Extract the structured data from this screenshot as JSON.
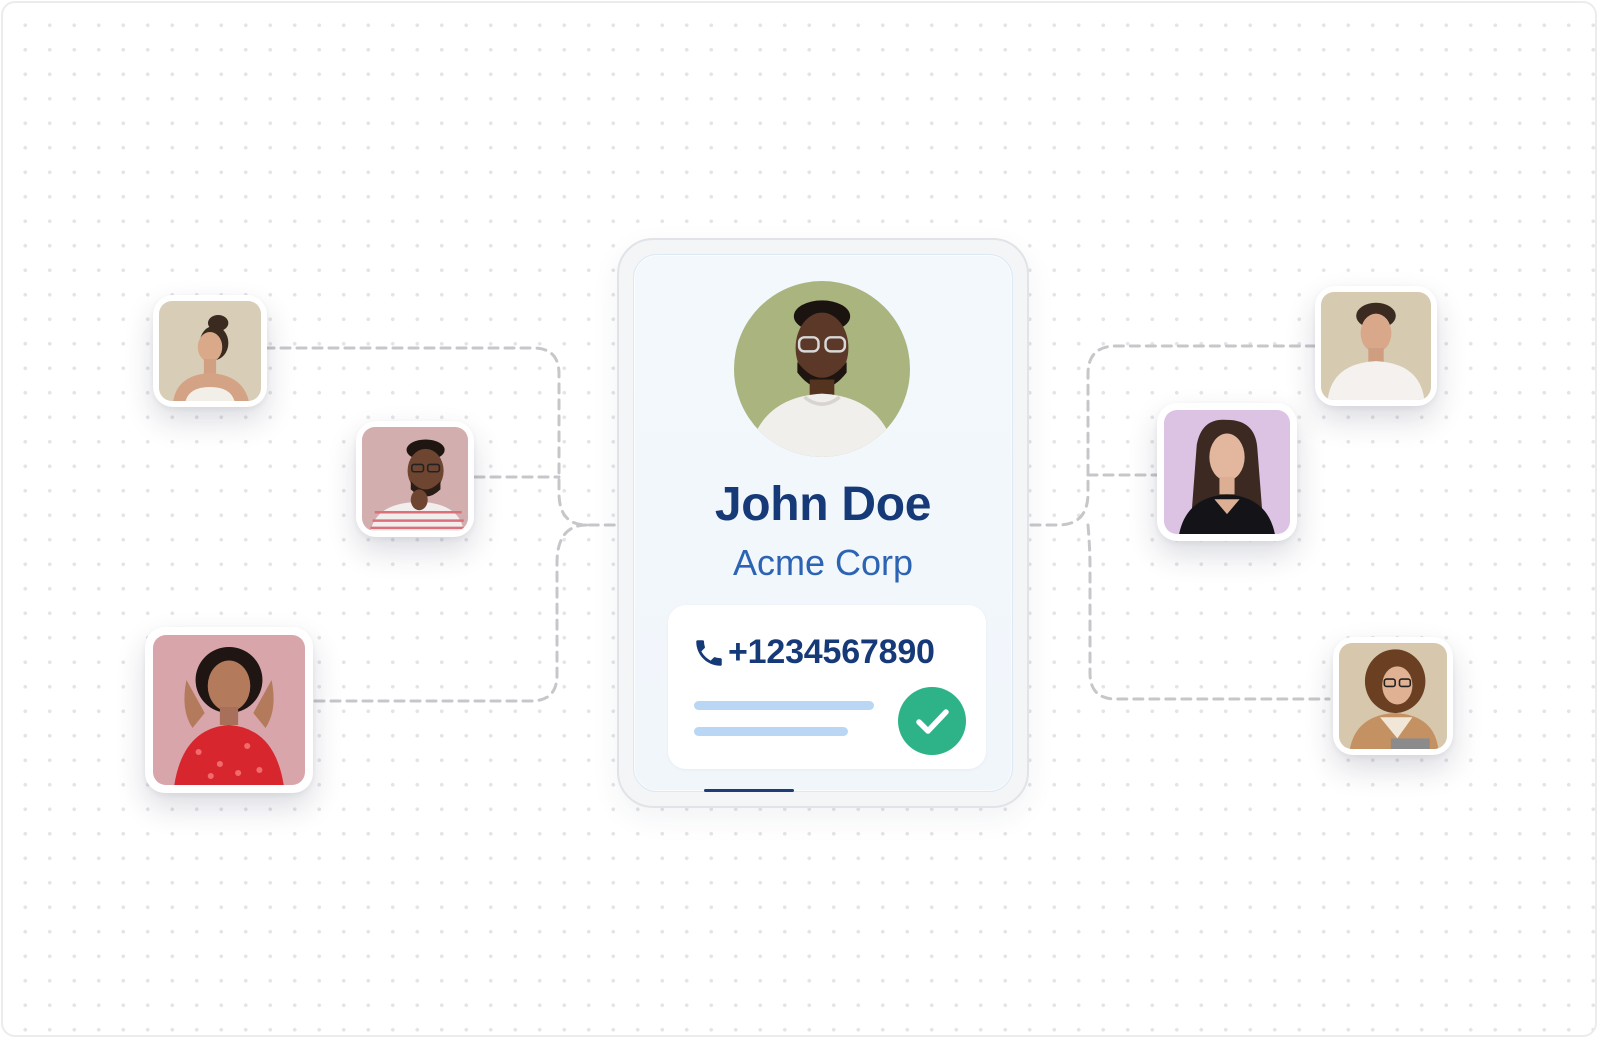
{
  "contact_card": {
    "name": "John Doe",
    "company": "Acme Corp",
    "phone": "+1234567890",
    "verified_icon": "check-circle-icon",
    "phone_icon": "phone-icon"
  },
  "avatars": [
    {
      "name": "avatar-woman-profile",
      "bg": "#d8cdb6"
    },
    {
      "name": "avatar-man-glasses-thinking",
      "bg": "#d3aeae"
    },
    {
      "name": "avatar-woman-red-dress",
      "bg": "#d7a5aa"
    },
    {
      "name": "avatar-man-white-tee",
      "bg": "#d6cbb0"
    },
    {
      "name": "avatar-woman-dark-hair",
      "bg": "#dcc2e3"
    },
    {
      "name": "avatar-woman-curly-glasses",
      "bg": "#d7c8ad"
    }
  ],
  "colors": {
    "name": "#163a78",
    "company": "#2c63b3",
    "check": "#2db387",
    "connector": "#c7c7cb"
  }
}
